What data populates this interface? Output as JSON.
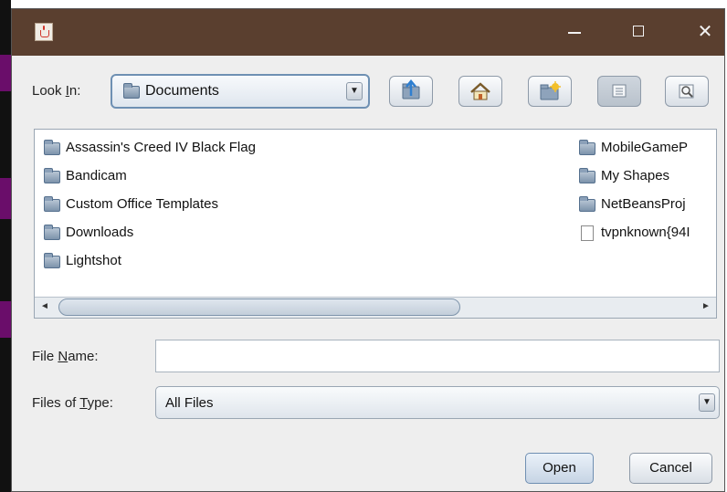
{
  "window": {
    "minimize_glyph": "—",
    "maximize_glyph": "☐",
    "close_glyph": "✕",
    "icon": "java-cup-icon"
  },
  "look_in": {
    "label_prefix": "Look ",
    "label_mnemonic": "I",
    "label_suffix": "n:",
    "value": "Documents"
  },
  "toolbar": [
    {
      "name": "up-one-level-button",
      "icon": "folder-up-icon"
    },
    {
      "name": "home-button",
      "icon": "home-icon"
    },
    {
      "name": "create-new-folder-button",
      "icon": "new-folder-icon"
    },
    {
      "name": "list-view-button",
      "icon": "list-icon",
      "selected": true
    },
    {
      "name": "details-view-button",
      "icon": "details-icon"
    }
  ],
  "files": {
    "column1": [
      {
        "name": "Assassin's Creed IV Black Flag",
        "type": "folder"
      },
      {
        "name": "Bandicam",
        "type": "folder"
      },
      {
        "name": "Custom Office Templates",
        "type": "folder"
      },
      {
        "name": "Downloads",
        "type": "folder"
      },
      {
        "name": "Lightshot",
        "type": "folder"
      }
    ],
    "column2": [
      {
        "name": "MobileGameP",
        "type": "folder"
      },
      {
        "name": "My Shapes",
        "type": "folder"
      },
      {
        "name": "NetBeansProj",
        "type": "folder"
      },
      {
        "name": "tvpnknown{94I",
        "type": "file"
      }
    ]
  },
  "file_name": {
    "label_prefix": "File ",
    "label_mnemonic": "N",
    "label_suffix": "ame:",
    "value": "",
    "placeholder": ""
  },
  "files_of_type": {
    "label_prefix": "Files of ",
    "label_mnemonic": "T",
    "label_suffix": "ype:",
    "value": "All Files"
  },
  "buttons": {
    "open": "Open",
    "cancel": "Cancel"
  },
  "colors": {
    "titlebar": "#5a3f2f",
    "dialog_bg": "#eeeeee",
    "accent_border": "#6e90b3"
  }
}
